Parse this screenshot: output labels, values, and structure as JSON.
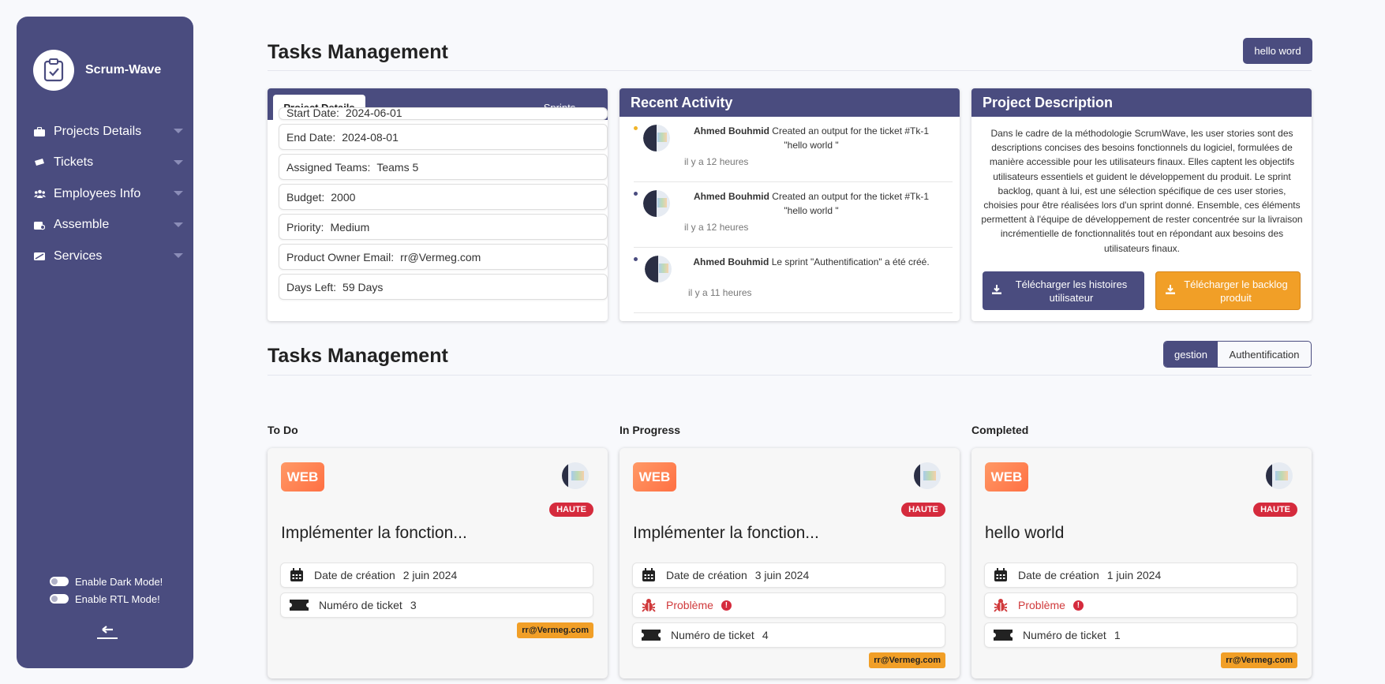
{
  "sidebar": {
    "brand": "Scrum-Wave",
    "items": [
      {
        "label": "Projects Details"
      },
      {
        "label": "Tickets"
      },
      {
        "label": "Employees Info"
      },
      {
        "label": "Assemble"
      },
      {
        "label": "Services"
      }
    ],
    "dark_mode_label": "Enable Dark Mode!",
    "rtl_mode_label": "Enable RTL Mode!"
  },
  "header": {
    "title": "Tasks Management",
    "user_button": "hello word"
  },
  "project_details": {
    "tabs": [
      "Project Details",
      "Sprints"
    ],
    "rows": [
      {
        "label": "Start Date:",
        "value": "2024-06-01"
      },
      {
        "label": "End Date:",
        "value": "2024-08-01"
      },
      {
        "label": "Assigned Teams:",
        "value": "Teams 5"
      },
      {
        "label": "Budget:",
        "value": "2000"
      },
      {
        "label": "Priority:",
        "value": "Medium"
      },
      {
        "label": "Product Owner Email:",
        "value": "rr@Vermeg.com"
      },
      {
        "label": "Days Left:",
        "value": "59 Days"
      }
    ]
  },
  "recent_activity": {
    "title": "Recent Activity",
    "items": [
      {
        "user": "Ahmed Bouhmid",
        "text": "Created an output for the ticket #Tk-1 \"hello world \"",
        "time": "il y a 12 heures"
      },
      {
        "user": "Ahmed Bouhmid",
        "text": "Created an output for the ticket #Tk-1 \"hello world \"",
        "time": "il y a 12 heures"
      },
      {
        "user": "Ahmed Bouhmid",
        "text": "Le sprint \"Authentification\" a été créé.",
        "time": "il y a 11 heures"
      }
    ]
  },
  "project_description": {
    "title": "Project Description",
    "text": "Dans le cadre de la méthodologie ScrumWave, les user stories sont des descriptions concises des besoins fonctionnels du logiciel, formulées de manière accessible pour les utilisateurs finaux. Elles captent les objectifs utilisateurs essentiels et guident le développement du produit. Le sprint backlog, quant à lui, est une sélection spécifique de ces user stories, choisies pour être réalisées lors d'un sprint donné. Ensemble, ces éléments permettent à l'équipe de développement de rester concentrée sur la livraison incrémentielle de fonctionnalités tout en répondant aux besoins des utilisateurs finaux.",
    "download_stories": "Télécharger les histoires utilisateur",
    "download_backlog": "Télécharger le backlog produit"
  },
  "board": {
    "title": "Tasks Management",
    "segments": [
      "gestion",
      "Authentification"
    ],
    "columns": [
      {
        "name": "To Do",
        "card": {
          "tag": "WEB",
          "priority": "HAUTE",
          "title": "Implémenter la fonction...",
          "created_label": "Date de création",
          "created_value": "2 juin 2024",
          "problem": "",
          "ticket_label": "Numéro de ticket",
          "ticket_value": "3",
          "email": "rr@Vermeg.com"
        }
      },
      {
        "name": "In Progress",
        "card": {
          "tag": "WEB",
          "priority": "HAUTE",
          "title": "Implémenter la fonction...",
          "created_label": "Date de création",
          "created_value": "3 juin 2024",
          "problem": "Problème",
          "ticket_label": "Numéro de ticket",
          "ticket_value": "4",
          "email": "rr@Vermeg.com"
        }
      },
      {
        "name": "Completed",
        "card": {
          "tag": "WEB",
          "priority": "HAUTE",
          "title": "hello world",
          "created_label": "Date de création",
          "created_value": "1 juin 2024",
          "problem": "Problème",
          "ticket_label": "Numéro de ticket",
          "ticket_value": "1",
          "email": "rr@Vermeg.com"
        }
      }
    ]
  },
  "colors": {
    "primary": "#4a4c7f",
    "accent": "#f19f27",
    "danger": "#d52b3d"
  }
}
